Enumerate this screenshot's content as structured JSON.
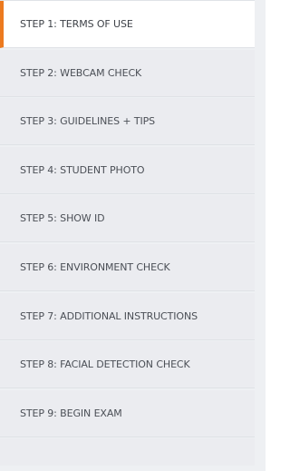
{
  "steps": {
    "items": [
      {
        "label": "STEP 1: TERMS OF USE",
        "active": true
      },
      {
        "label": "STEP 2: WEBCAM CHECK",
        "active": false
      },
      {
        "label": "STEP 3: GUIDELINES + TIPS",
        "active": false
      },
      {
        "label": "STEP 4: STUDENT PHOTO",
        "active": false
      },
      {
        "label": "STEP 5: SHOW ID",
        "active": false
      },
      {
        "label": "STEP 6: ENVIRONMENT CHECK",
        "active": false
      },
      {
        "label": "STEP 7: ADDITIONAL INSTRUCTIONS",
        "active": false
      },
      {
        "label": "STEP 8: FACIAL DETECTION CHECK",
        "active": false
      },
      {
        "label": "STEP 9: BEGIN EXAM",
        "active": false
      }
    ]
  },
  "colors": {
    "active_accent": "#ec7a1f",
    "active_background": "#ffffff",
    "inactive_background": "#ebecf0",
    "text": "#4b4f56"
  }
}
